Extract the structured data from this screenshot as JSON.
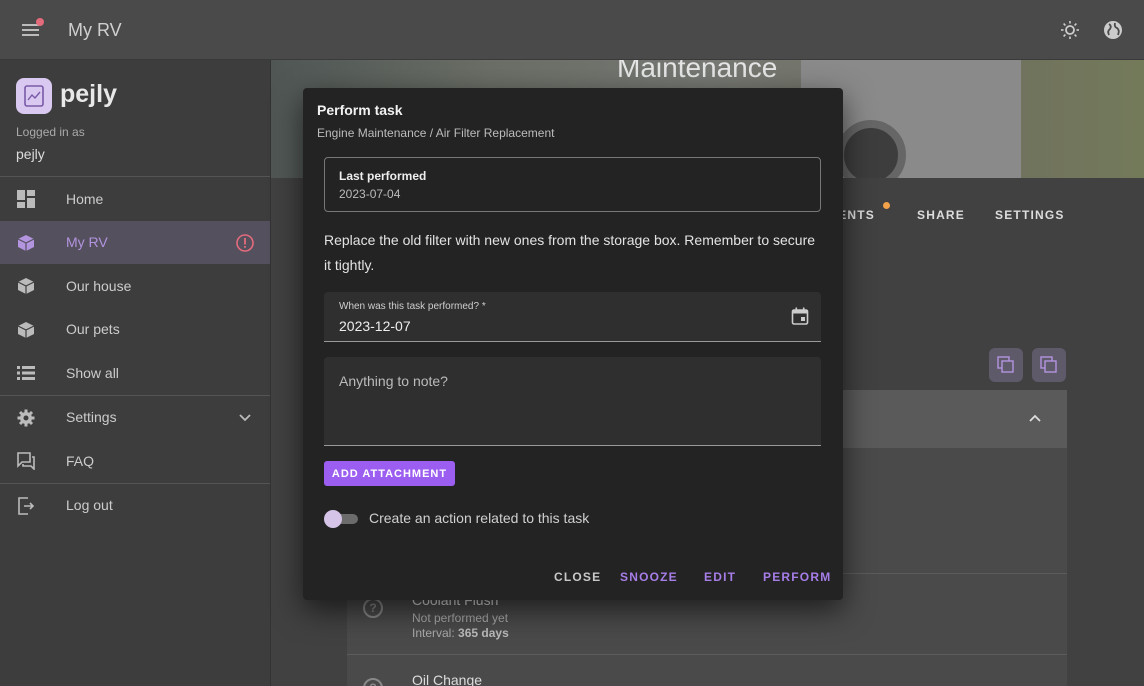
{
  "app": {
    "title": "My RV",
    "brand": "pejly",
    "logged_in_as_label": "Logged in as",
    "username": "pejly"
  },
  "colors": {
    "accent": "#9c5ef0",
    "accent_text": "#b394df",
    "alert": "#e46b7c",
    "badge": "#f2a24a"
  },
  "sidebar": {
    "items": [
      {
        "label": "Home",
        "icon": "dashboard-icon"
      },
      {
        "label": "My RV",
        "icon": "cube-icon",
        "active": true,
        "trailing": "alert-icon"
      },
      {
        "label": "Our house",
        "icon": "cube-icon"
      },
      {
        "label": "Our pets",
        "icon": "cube-icon"
      },
      {
        "label": "Show all",
        "icon": "list-icon"
      },
      {
        "label": "Settings",
        "icon": "gear-icon",
        "trailing": "chevron-down-icon"
      },
      {
        "label": "FAQ",
        "icon": "faq-icon"
      },
      {
        "label": "Log out",
        "icon": "logout-icon"
      }
    ]
  },
  "main": {
    "hero_title": "Maintenance",
    "tabs": [
      {
        "label": "MENTS"
      },
      {
        "label": "SHARE"
      },
      {
        "label": "SETTINGS"
      }
    ],
    "rows": [
      {
        "title": "Coolant Flush",
        "status": "Not performed yet",
        "interval_label": "Interval:",
        "interval": "365 days"
      },
      {
        "title": "Oil Change"
      }
    ]
  },
  "dialog": {
    "title": "Perform task",
    "subtitle": "Engine Maintenance / Air Filter Replacement",
    "last_performed_label": "Last performed",
    "last_performed_value": "2023-07-04",
    "description": "Replace the old filter with new ones from the storage box. Remember to secure it tightly.",
    "date_label": "When was this task performed? *",
    "date_value": "2023-12-07",
    "note_placeholder": "Anything to note?",
    "add_attachment": "ADD ATTACHMENT",
    "toggle_label": "Create an action related to this task",
    "toggle_on": false,
    "actions": {
      "close": "CLOSE",
      "snooze": "SNOOZE",
      "edit": "EDIT",
      "perform": "PERFORM"
    }
  }
}
